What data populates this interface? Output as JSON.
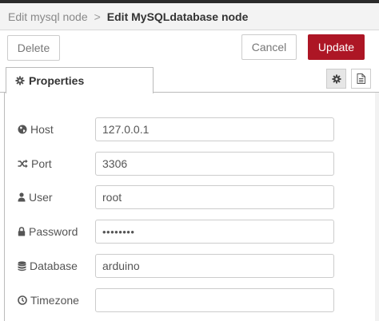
{
  "header": {
    "breadcrumb": "Edit mysql node",
    "separator": ">",
    "title": "Edit MySQLdatabase node"
  },
  "toolbar": {
    "delete_label": "Delete",
    "cancel_label": "Cancel",
    "update_label": "Update",
    "update_color": "#ad1625"
  },
  "tabs": {
    "properties_label": "Properties",
    "settings_icon": "gear-icon",
    "description_icon": "document-icon"
  },
  "form": {
    "host": {
      "label": "Host",
      "value": "127.0.0.1",
      "icon": "globe-icon"
    },
    "port": {
      "label": "Port",
      "value": "3306",
      "icon": "random-icon"
    },
    "user": {
      "label": "User",
      "value": "root",
      "icon": "user-icon"
    },
    "password": {
      "label": "Password",
      "value": "••••••••",
      "icon": "lock-icon"
    },
    "database": {
      "label": "Database",
      "value": "arduino",
      "icon": "database-icon"
    },
    "timezone": {
      "label": "Timezone",
      "value": "",
      "icon": "clock-icon"
    }
  }
}
